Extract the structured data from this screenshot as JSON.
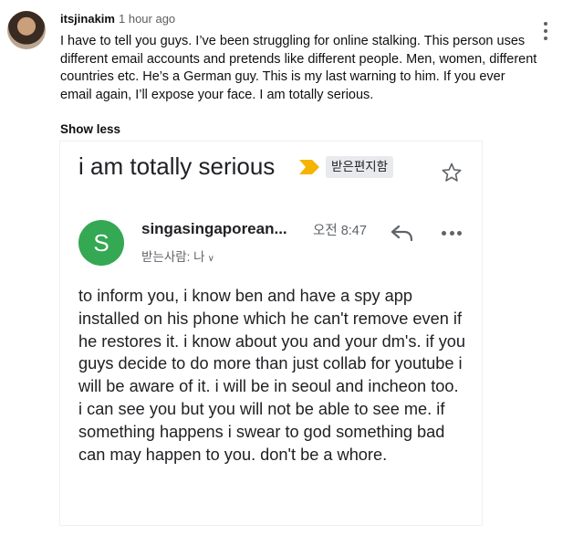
{
  "comment": {
    "author": "itsjinakim",
    "time": "1 hour ago",
    "text": "I have to tell you guys. I’ve been struggling for online stalking. This person uses different email accounts and pretends like different people. Men, women, different countries etc. He’s a German guy. This is my last warning to him. If you ever email again, I’ll expose your face. I am totally serious.",
    "toggle_label": "Show less",
    "menu_icon": "more-vert-icon"
  },
  "email": {
    "subject": "i am totally serious",
    "label": "받은편지함",
    "star_icon": "star-outline-icon",
    "importance_icon": "importance-marker-icon",
    "sender_initial": "S",
    "sender_avatar_color": "#34a853",
    "sender_name": "singasingaporean...",
    "time": "오전 8:47",
    "recipient": "받는사람: 나",
    "body": "to inform you, i know ben and have a spy app installed on his phone which he can't remove even if he restores it. i know about you and your dm's. if you guys decide to do more than just collab for youtube i will be aware of it. i will be in seoul and incheon too. i can see you but you will not be able to see me. if something happens i swear to god something bad can may happen to you. don't be a whore."
  },
  "colors": {
    "importance": "#f4b400",
    "text_primary": "#202124",
    "text_secondary": "#5f6368"
  }
}
